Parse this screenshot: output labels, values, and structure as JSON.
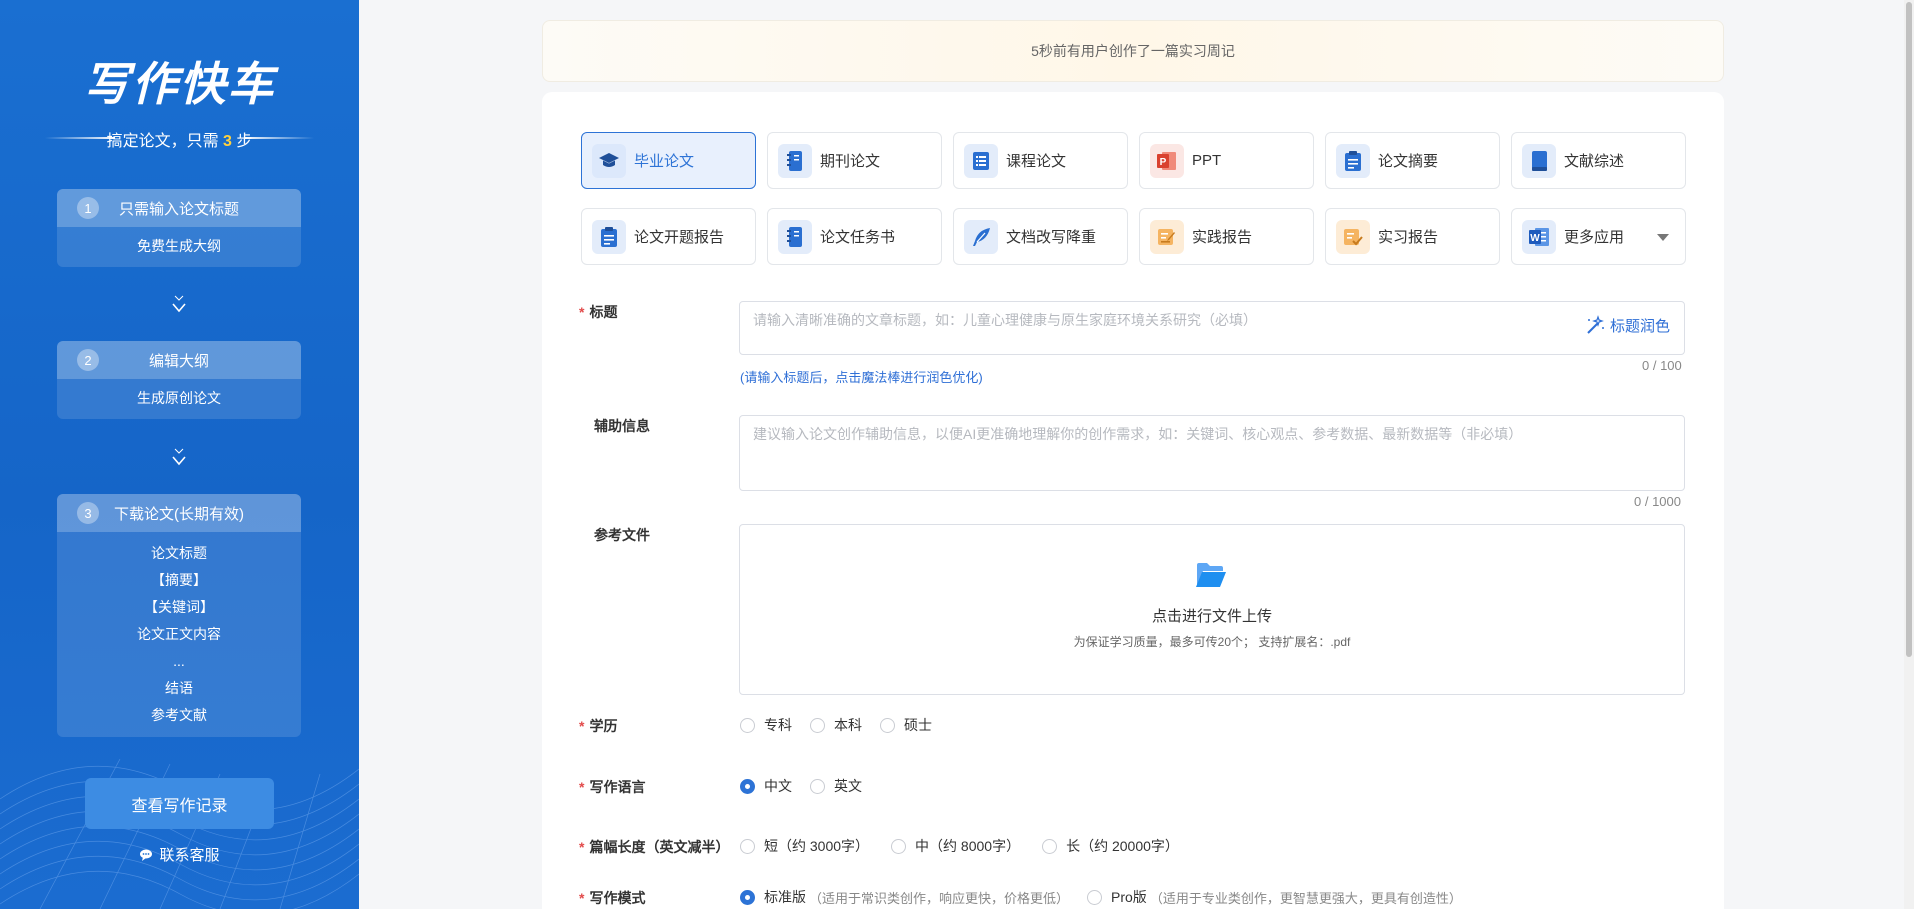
{
  "sidebar": {
    "logo": "写作快车",
    "slogan_prefix": "搞定论文，只需",
    "slogan_num": "3",
    "slogan_suffix": "步",
    "steps": [
      {
        "num": "1",
        "title": "只需输入论文标题",
        "items": [
          "免费生成大纲"
        ]
      },
      {
        "num": "2",
        "title": "编辑大纲",
        "items": [
          "生成原创论文"
        ]
      },
      {
        "num": "3",
        "title": "下载论文(长期有效)",
        "items": [
          "论文标题",
          "【摘要】",
          "【关键词】",
          "论文正文内容",
          "...",
          "结语",
          "参考文献"
        ]
      }
    ],
    "history_button": "查看写作记录",
    "service_link": "联系客服"
  },
  "notice": "5秒前有用户创作了一篇实习周记",
  "tiles": [
    {
      "label": "毕业论文",
      "icon": "graduation-cap-icon"
    },
    {
      "label": "期刊论文",
      "icon": "journal-icon"
    },
    {
      "label": "课程论文",
      "icon": "list-book-icon"
    },
    {
      "label": "PPT",
      "icon": "ppt-icon"
    },
    {
      "label": "论文摘要",
      "icon": "clipboard-icon"
    },
    {
      "label": "文献综述",
      "icon": "book-icon"
    },
    {
      "label": "论文开题报告",
      "icon": "clipboard-icon"
    },
    {
      "label": "论文任务书",
      "icon": "journal-icon"
    },
    {
      "label": "文档改写降重",
      "icon": "feather-icon"
    },
    {
      "label": "实践报告",
      "icon": "edit-note-icon"
    },
    {
      "label": "实习报告",
      "icon": "check-note-icon"
    },
    {
      "label": "更多应用",
      "icon": "word-icon"
    }
  ],
  "form": {
    "title_label": "标题",
    "title_placeholder": "请输入清晰准确的文章标题，如：儿童心理健康与原生家庭环境关系研究（必填）",
    "title_counter": "0 / 100",
    "title_hint": "(请输入标题后，点击魔法棒进行润色优化)",
    "polish_label": "标题润色",
    "aux_label": "辅助信息",
    "aux_placeholder": "建议输入论文创作辅助信息，以便AI更准确地理解你的创作需求，如：关键词、核心观点、参考数据、最新数据等（非必填）",
    "aux_counter": "0 / 1000",
    "ref_label": "参考文件",
    "upload_title": "点击进行文件上传",
    "upload_sub": "为保证学习质量，最多可传20个； 支持扩展名：.pdf",
    "education_label": "学历",
    "education_options": [
      "专科",
      "本科",
      "硕士"
    ],
    "language_label": "写作语言",
    "language_options": [
      "中文",
      "英文"
    ],
    "length_label": "篇幅长度（英文减半）",
    "length_options": [
      "短（约 3000字）",
      "中（约 8000字）",
      "长（约 20000字）"
    ],
    "mode_label": "写作模式",
    "mode_options": [
      {
        "name": "标准版",
        "desc": "（适用于常识类创作，响应更快，价格更低）"
      },
      {
        "name": "Pro版",
        "desc": "（适用于专业类创作，更智慧更强大，更具有创造性）"
      }
    ]
  }
}
